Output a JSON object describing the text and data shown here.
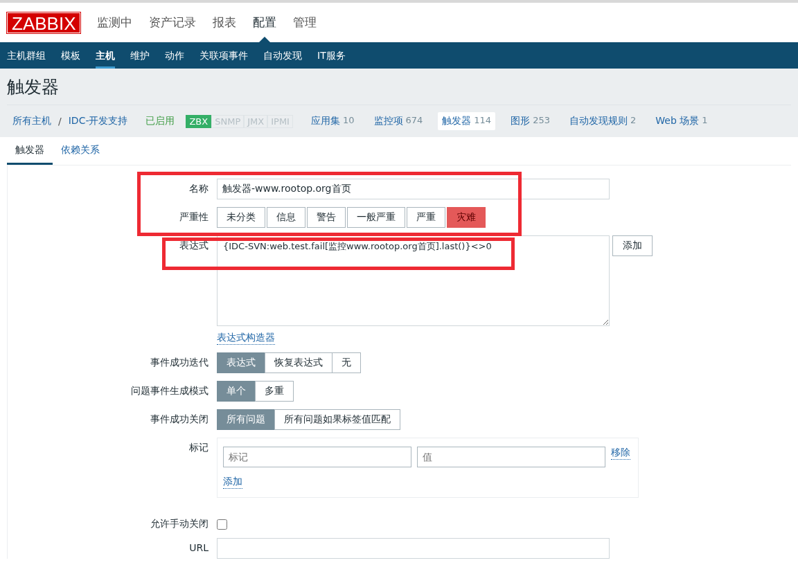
{
  "logo": "ZABBIX",
  "main_menu": [
    {
      "label": "监测中",
      "selected": false
    },
    {
      "label": "资产记录",
      "selected": false
    },
    {
      "label": "报表",
      "selected": false
    },
    {
      "label": "配置",
      "selected": true
    },
    {
      "label": "管理",
      "selected": false
    }
  ],
  "sub_menu": [
    {
      "label": "主机群组",
      "selected": false
    },
    {
      "label": "模板",
      "selected": false
    },
    {
      "label": "主机",
      "selected": true
    },
    {
      "label": "维护",
      "selected": false
    },
    {
      "label": "动作",
      "selected": false
    },
    {
      "label": "关联项事件",
      "selected": false
    },
    {
      "label": "自动发现",
      "selected": false
    },
    {
      "label": "IT服务",
      "selected": false
    }
  ],
  "page_title": "触发器",
  "breadcrumb": {
    "items": [
      "所有主机",
      "IDC-开发支持"
    ],
    "separator": "/"
  },
  "host_status": "已启用",
  "availability": [
    {
      "label": "ZBX",
      "on": true
    },
    {
      "label": "SNMP",
      "on": false
    },
    {
      "label": "JMX",
      "on": false
    },
    {
      "label": "IPMI",
      "on": false
    }
  ],
  "host_links": [
    {
      "label": "应用集",
      "count": "10",
      "selected": false
    },
    {
      "label": "监控项",
      "count": "674",
      "selected": false
    },
    {
      "label": "触发器",
      "count": "114",
      "selected": true
    },
    {
      "label": "图形",
      "count": "253",
      "selected": false
    },
    {
      "label": "自动发现规则",
      "count": "2",
      "selected": false
    },
    {
      "label": "Web 场景",
      "count": "1",
      "selected": false
    }
  ],
  "tabs": [
    {
      "label": "触发器",
      "selected": true
    },
    {
      "label": "依赖关系",
      "selected": false
    }
  ],
  "form": [
    {
      "kind": "text",
      "label": "名称",
      "value": "触发器-www.rootop.org首页"
    },
    {
      "kind": "severity",
      "label": "严重性",
      "options": [
        {
          "label": "未分类",
          "selected": false
        },
        {
          "label": "信息",
          "selected": false
        },
        {
          "label": "警告",
          "selected": false
        },
        {
          "label": "一般严重",
          "selected": false
        },
        {
          "label": "严重",
          "selected": false
        },
        {
          "label": "灾难",
          "selected": true
        }
      ]
    },
    {
      "kind": "expression",
      "label": "表达式",
      "value": "{IDC-SVN:web.test.fail[监控www.rootop.org首页].last()}<>0",
      "button": "添加",
      "link": "表达式构造器"
    },
    {
      "kind": "radio",
      "label": "事件成功迭代",
      "options": [
        {
          "label": "表达式",
          "selected": true
        },
        {
          "label": "恢复表达式",
          "selected": false
        },
        {
          "label": "无",
          "selected": false
        }
      ]
    },
    {
      "kind": "radio",
      "label": "问题事件生成模式",
      "options": [
        {
          "label": "单个",
          "selected": true
        },
        {
          "label": "多重",
          "selected": false
        }
      ]
    },
    {
      "kind": "radio",
      "label": "事件成功关闭",
      "options": [
        {
          "label": "所有问题",
          "selected": true
        },
        {
          "label": "所有问题如果标签值匹配",
          "selected": false
        }
      ]
    },
    {
      "kind": "tags",
      "label": "标记",
      "tag_placeholder": "标记",
      "value_placeholder": "值",
      "remove": "移除",
      "add": "添加"
    },
    {
      "kind": "checkbox",
      "label": "允许手动关闭",
      "checked": false
    },
    {
      "kind": "text",
      "label": "URL"
    }
  ],
  "annotations": [
    {
      "kind": "frame"
    },
    {
      "kind": "frame"
    }
  ]
}
